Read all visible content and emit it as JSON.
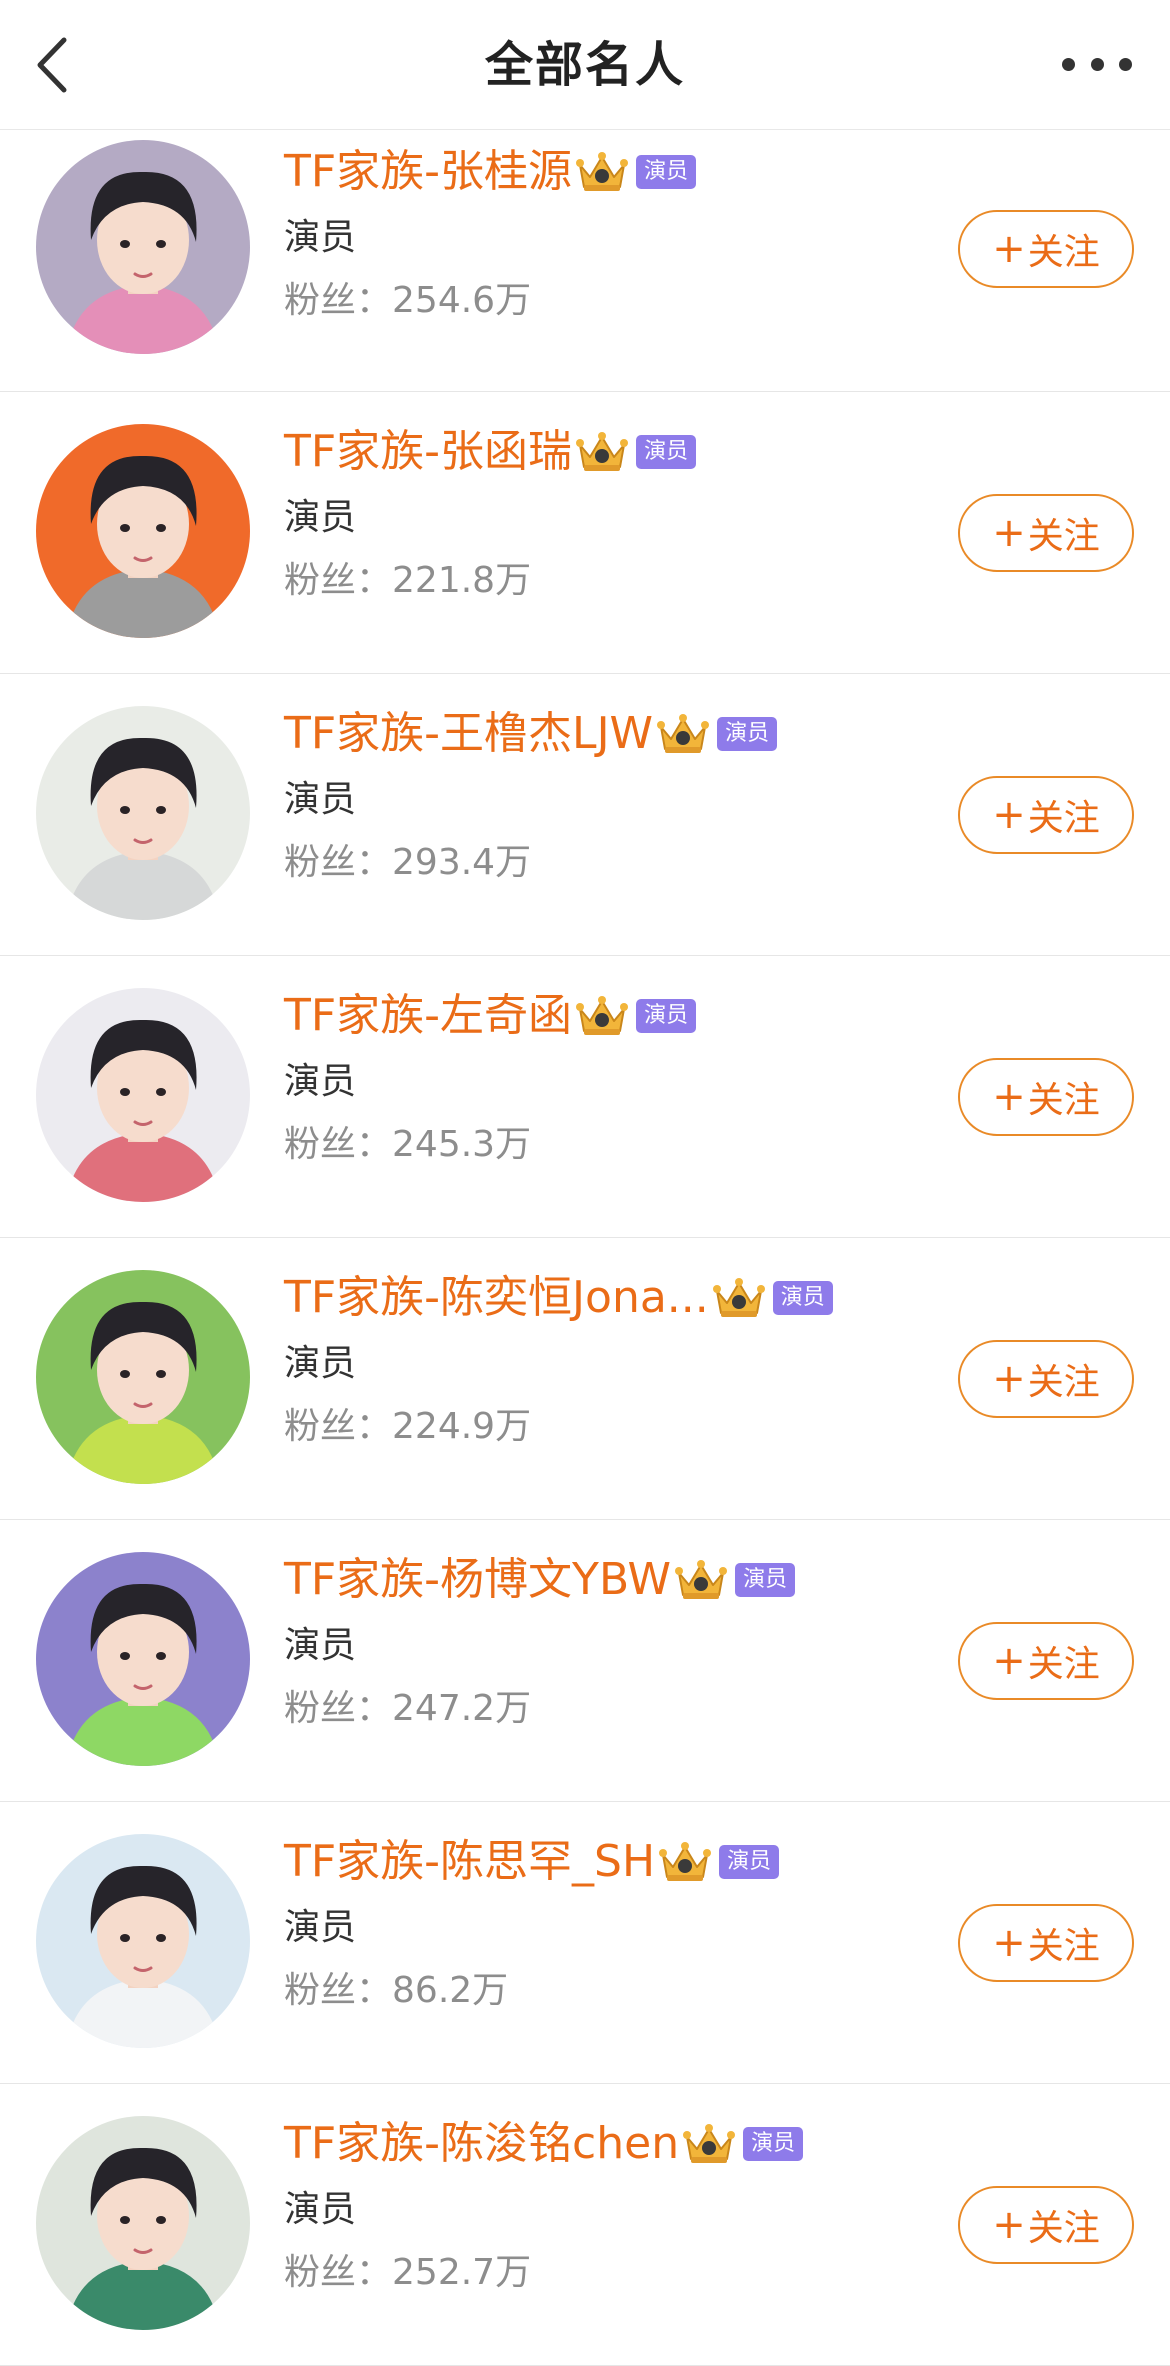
{
  "header": {
    "title": "全部名人"
  },
  "list": {
    "follow_label": "关注",
    "fans_prefix": "粉丝：",
    "items": [
      {
        "name": "TF家族-张桂源",
        "badge": "演员",
        "role": "演员",
        "fans": "254.6万",
        "avatar_bg": "#b4aac4",
        "shirt": "#e48fb8"
      },
      {
        "name": "TF家族-张函瑞",
        "badge": "演员",
        "role": "演员",
        "fans": "221.8万",
        "avatar_bg": "#f06a2a",
        "shirt": "#9c9c9c"
      },
      {
        "name": "TF家族-王橹杰LJW",
        "badge": "演员",
        "role": "演员",
        "fans": "293.4万",
        "avatar_bg": "#e9ece7",
        "shirt": "#d6d8d8"
      },
      {
        "name": "TF家族-左奇函",
        "badge": "演员",
        "role": "演员",
        "fans": "245.3万",
        "avatar_bg": "#ecebf0",
        "shirt": "#e0707c"
      },
      {
        "name": "TF家族-陈奕恒Jona...",
        "badge": "演员",
        "role": "演员",
        "fans": "224.9万",
        "avatar_bg": "#86c25e",
        "shirt": "#c3e04e"
      },
      {
        "name": "TF家族-杨博文YBW",
        "badge": "演员",
        "role": "演员",
        "fans": "247.2万",
        "avatar_bg": "#8c82cc",
        "shirt": "#8ed864"
      },
      {
        "name": "TF家族-陈思罕_SH",
        "badge": "演员",
        "role": "演员",
        "fans": "86.2万",
        "avatar_bg": "#dae8f2",
        "shirt": "#f2f4f6"
      },
      {
        "name": "TF家族-陈浚铭chen",
        "badge": "演员",
        "role": "演员",
        "fans": "252.7万",
        "avatar_bg": "#dfe5dd",
        "shirt": "#3a8a6a"
      }
    ]
  },
  "colors": {
    "accent": "#ea6c17",
    "badge": "#8e7bea",
    "follow_border": "#e98a27"
  },
  "icons": {
    "back": "chevron-left-icon",
    "more": "more-dots-icon",
    "crown": "crown-icon"
  }
}
